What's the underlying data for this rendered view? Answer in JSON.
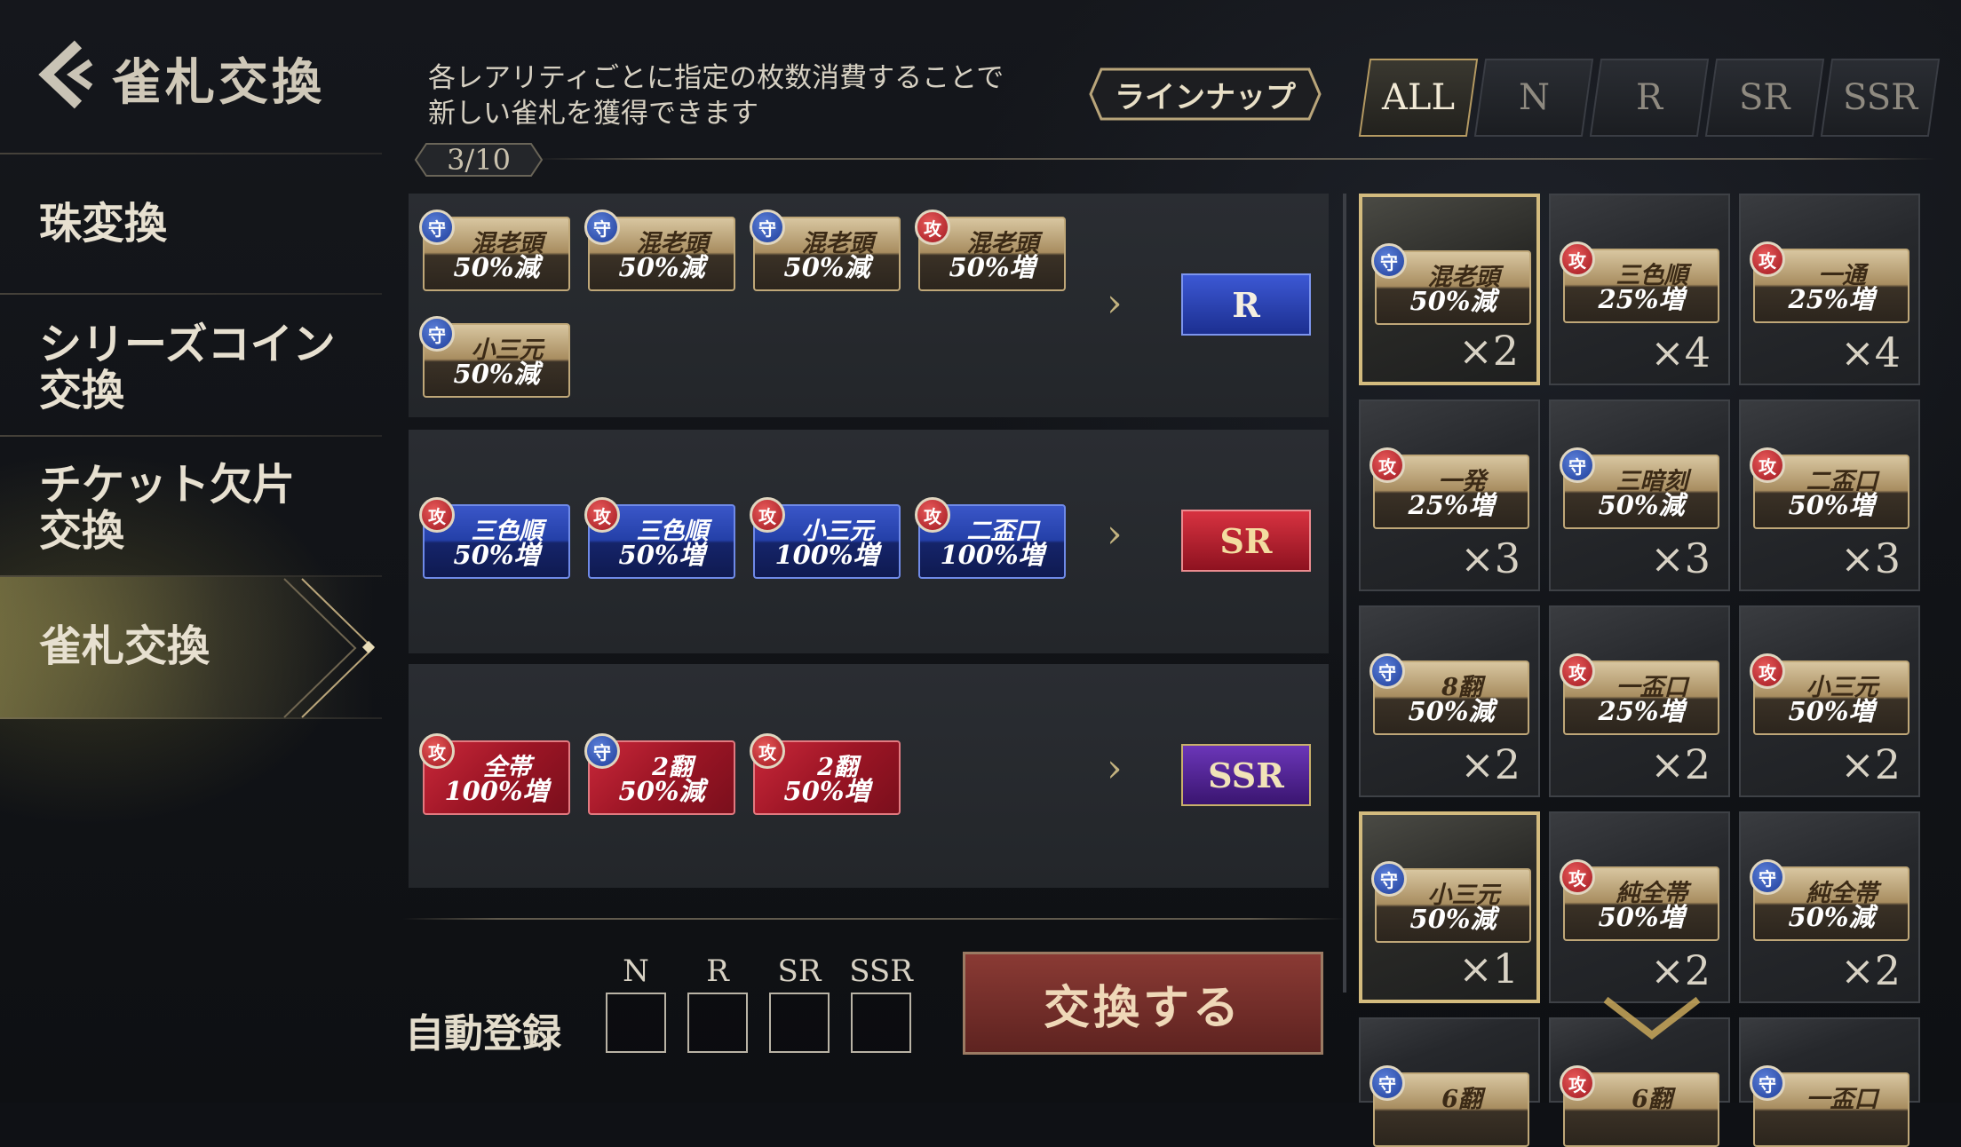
{
  "header": {
    "title": "雀札交換",
    "description_line1": "各レアリティごとに指定の枚数消費することで",
    "description_line2": "新しい雀札を獲得できます",
    "lineup_label": "ラインナップ",
    "page_indicator": "3/10"
  },
  "filter_tabs": [
    "ALL",
    "N",
    "R",
    "SR",
    "SSR"
  ],
  "sidebar": {
    "items": [
      {
        "label": "珠変換"
      },
      {
        "label": "シリーズコイン\n交換"
      },
      {
        "label": "チケット欠片\n交換"
      },
      {
        "label": "雀札交換"
      }
    ]
  },
  "exchange_rows": [
    {
      "cards": [
        {
          "type_icon": "守",
          "name": "混老頭",
          "effect": "50%減",
          "style": "gold"
        },
        {
          "type_icon": "守",
          "name": "混老頭",
          "effect": "50%減",
          "style": "gold"
        },
        {
          "type_icon": "守",
          "name": "混老頭",
          "effect": "50%減",
          "style": "gold"
        },
        {
          "type_icon": "攻",
          "name": "混老頭",
          "effect": "50%増",
          "style": "gold"
        },
        {
          "type_icon": "守",
          "name": "小三元",
          "effect": "50%減",
          "style": "gold"
        }
      ],
      "reward": "R"
    },
    {
      "cards": [
        {
          "type_icon": "攻",
          "name": "三色順",
          "effect": "50%増",
          "style": "blue"
        },
        {
          "type_icon": "攻",
          "name": "三色順",
          "effect": "50%増",
          "style": "blue"
        },
        {
          "type_icon": "攻",
          "name": "小三元",
          "effect": "100%増",
          "style": "blue"
        },
        {
          "type_icon": "攻",
          "name": "二盃口",
          "effect": "100%増",
          "style": "blue"
        }
      ],
      "reward": "SR"
    },
    {
      "cards": [
        {
          "type_icon": "攻",
          "name": "全帯",
          "effect": "100%増",
          "style": "red"
        },
        {
          "type_icon": "守",
          "name": "2翻",
          "effect": "50%減",
          "style": "red"
        },
        {
          "type_icon": "攻",
          "name": "2翻",
          "effect": "50%増",
          "style": "red"
        }
      ],
      "reward": "SSR"
    }
  ],
  "inventory": [
    {
      "type_icon": "守",
      "name": "混老頭",
      "effect": "50%減",
      "count": "×2",
      "selected": true
    },
    {
      "type_icon": "攻",
      "name": "三色順",
      "effect": "25%増",
      "count": "×4",
      "selected": false
    },
    {
      "type_icon": "攻",
      "name": "一通",
      "effect": "25%増",
      "count": "×4",
      "selected": false
    },
    {
      "type_icon": "攻",
      "name": "一発",
      "effect": "25%増",
      "count": "×3",
      "selected": false
    },
    {
      "type_icon": "守",
      "name": "三暗刻",
      "effect": "50%減",
      "count": "×3",
      "selected": false
    },
    {
      "type_icon": "攻",
      "name": "二盃口",
      "effect": "50%増",
      "count": "×3",
      "selected": false
    },
    {
      "type_icon": "守",
      "name": "8翻",
      "effect": "50%減",
      "count": "×2",
      "selected": false
    },
    {
      "type_icon": "攻",
      "name": "一盃口",
      "effect": "25%増",
      "count": "×2",
      "selected": false
    },
    {
      "type_icon": "攻",
      "name": "小三元",
      "effect": "50%増",
      "count": "×2",
      "selected": false
    },
    {
      "type_icon": "守",
      "name": "小三元",
      "effect": "50%減",
      "count": "×1",
      "selected": true
    },
    {
      "type_icon": "攻",
      "name": "純全帯",
      "effect": "50%増",
      "count": "×2",
      "selected": false
    },
    {
      "type_icon": "守",
      "name": "純全帯",
      "effect": "50%減",
      "count": "×2",
      "selected": false
    },
    {
      "type_icon": "守",
      "name": "6翻",
      "effect": "",
      "count": "",
      "selected": false
    },
    {
      "type_icon": "攻",
      "name": "6翻",
      "effect": "",
      "count": "",
      "selected": false
    },
    {
      "type_icon": "守",
      "name": "一盃口",
      "effect": "",
      "count": "",
      "selected": false
    }
  ],
  "auto_register": {
    "label": "自動登録",
    "options": [
      "N",
      "R",
      "SR",
      "SSR"
    ]
  },
  "exchange_button": "交換する"
}
